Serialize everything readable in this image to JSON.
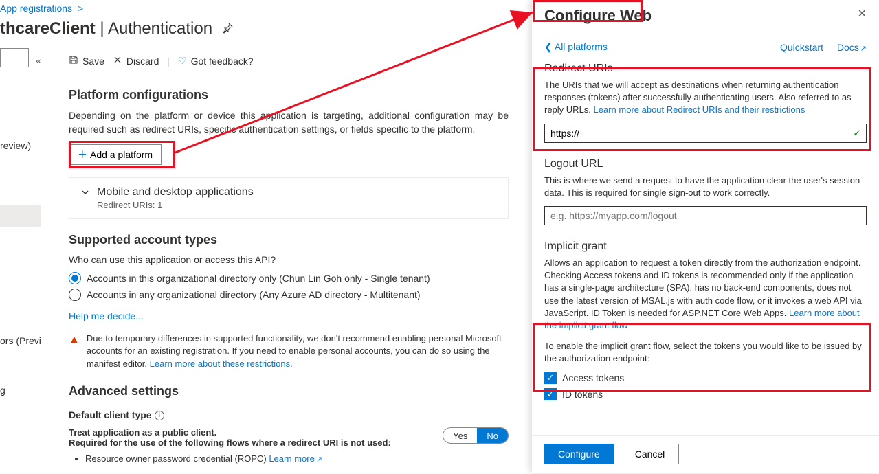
{
  "breadcrumb": {
    "item1": "App registrations"
  },
  "title": {
    "app": "thcareClient",
    "suffix": "Authentication"
  },
  "toolbar": {
    "save": "Save",
    "discard": "Discard",
    "feedback": "Got feedback?"
  },
  "left": {
    "preview": "review)",
    "errors": "ors (Preview)",
    "log": "g"
  },
  "platform": {
    "heading": "Platform configurations",
    "desc": "Depending on the platform or device this application is targeting, additional configuration may be required such as redirect URIs, specific authentication settings, or fields specific to the platform.",
    "add": "Add a platform",
    "expander_title": "Mobile and desktop applications",
    "expander_sub": "Redirect URIs: 1"
  },
  "accounts": {
    "heading": "Supported account types",
    "question": "Who can use this application or access this API?",
    "opt1": "Accounts in this organizational directory only (Chun Lin Goh only - Single tenant)",
    "opt2": "Accounts in any organizational directory (Any Azure AD directory - Multitenant)",
    "help": "Help me decide...",
    "warn": "Due to temporary differences in supported functionality, we don't recommend enabling personal Microsoft accounts for an existing registration. If you need to enable personal accounts, you can do so using the manifest editor. ",
    "warn_link": "Learn more about these restrictions."
  },
  "advanced": {
    "heading": "Advanced settings",
    "default_client": "Default client type",
    "treat": "Treat application as a public client.",
    "required": "Required for the use of the following flows where a redirect URI is not used:",
    "yes": "Yes",
    "no": "No",
    "bullet1": "Resource owner password credential (ROPC) ",
    "bullet1_link": "Learn more"
  },
  "panel": {
    "title": "Configure Web",
    "back": "All platforms",
    "quickstart": "Quickstart",
    "docs": "Docs",
    "redirect_heading": "Redirect URIs",
    "redirect_desc": "The URIs that we will accept as destinations when returning authentication responses (tokens) after successfully authenticating users. Also referred to as reply URLs. ",
    "redirect_link": "Learn more about Redirect URIs and their restrictions",
    "redirect_value": "https://",
    "logout_heading": "Logout URL",
    "logout_desc": "This is where we send a request to have the application clear the user's session data. This is required for single sign-out to work correctly.",
    "logout_placeholder": "e.g. https://myapp.com/logout",
    "implicit_heading": "Implicit grant",
    "implicit_desc": "Allows an application to request a token directly from the authorization endpoint. Checking Access tokens and ID tokens is recommended only if the application has a single-page architecture (SPA), has no back-end components, does not use the latest version of MSAL.js with auth code flow, or it invokes a web API via JavaScript. ID Token is needed for ASP.NET Core Web Apps. ",
    "implicit_link": "Learn more about the implicit grant flow",
    "implicit_enable": "To enable the implicit grant flow, select the tokens you would like to be issued by the authorization endpoint:",
    "access_tokens": "Access tokens",
    "id_tokens": "ID tokens",
    "configure": "Configure",
    "cancel": "Cancel"
  }
}
